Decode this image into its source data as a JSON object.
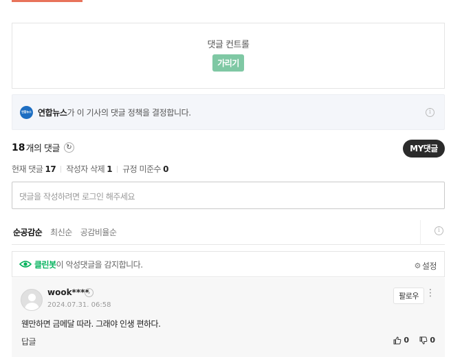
{
  "control": {
    "title": "댓글 컨트롤",
    "hide_label": "가리기"
  },
  "policy": {
    "publisher": "연합뉴스",
    "text": "가 이 기사의 댓글 정책을 결정합니다.",
    "logo_text": "연합뉴스"
  },
  "summary": {
    "count": "18",
    "count_label": "개의 댓글",
    "my_button": "MY댓글"
  },
  "stats": [
    {
      "label": "현재 댓글",
      "value": "17"
    },
    {
      "label": "작성자 삭제",
      "value": "1"
    },
    {
      "label": "규정 미준수",
      "value": "0"
    }
  ],
  "login_prompt": "댓글을 작성하려면 로그인 해주세요",
  "sort_tabs": [
    {
      "label": "순공감순",
      "active": true
    },
    {
      "label": "최신순",
      "active": false
    },
    {
      "label": "공감비율순",
      "active": false
    }
  ],
  "cleanbot": {
    "name": "클린봇",
    "text": "이 악성댓글을 감지합니다.",
    "settings_label": "설정"
  },
  "comment": {
    "username": "wook****",
    "timestamp": "2024.07.31. 06:58",
    "follow_label": "팔로우",
    "text": "웬만하면 금메달 따라. 그래야 인생 편하다.",
    "reply_label": "답글",
    "likes": "0",
    "dislikes": "0"
  },
  "colors": {
    "accent_green": "#03b25c",
    "hide_button": "#7fc8a4",
    "logo_blue": "#1d6ec2",
    "top_bar": "#e8735a"
  }
}
